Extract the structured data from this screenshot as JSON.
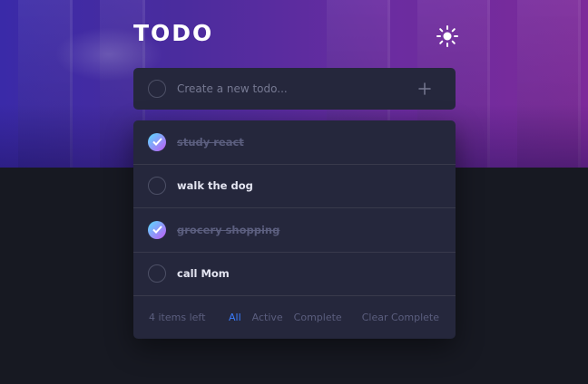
{
  "app": {
    "title": "TODO"
  },
  "theme_toggle": {
    "icon": "sun-icon"
  },
  "new_todo": {
    "placeholder": "Create a new todo...",
    "add_icon": "plus-icon"
  },
  "todos": [
    {
      "label": "study react",
      "completed": true
    },
    {
      "label": "walk the dog",
      "completed": false
    },
    {
      "label": "grocery shopping",
      "completed": true
    },
    {
      "label": "call Mom",
      "completed": false
    }
  ],
  "footer": {
    "items_left": "4 items left",
    "filters": [
      "All",
      "Active",
      "Complete"
    ],
    "active_filter": "All",
    "clear": "Clear Complete"
  },
  "colors": {
    "background": "#171922",
    "card": "#25273c",
    "accent": "#3a7cfd",
    "check_gradient_start": "#57ddff",
    "check_gradient_end": "#c058f3"
  }
}
